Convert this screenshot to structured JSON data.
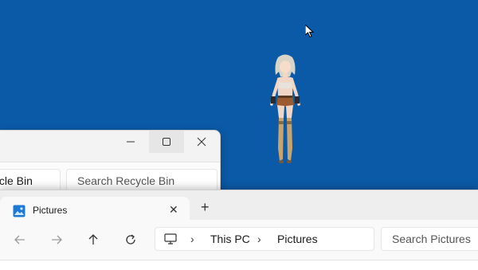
{
  "desktop": {
    "background": "#0b5aa7"
  },
  "recycle_window": {
    "breadcrumb": "Recycle Bin",
    "search_placeholder": "Search Recycle Bin",
    "controls": {
      "minimize": "—",
      "maximize": "☐",
      "close": "✕"
    }
  },
  "pictures_window": {
    "tab_label": "Pictures",
    "tab_close": "✕",
    "new_tab": "+",
    "nav": {
      "back": "←",
      "forward": "→",
      "up": "↑",
      "refresh": "↻"
    },
    "address": {
      "items": [
        "This PC",
        "Pictures"
      ],
      "separator": "›"
    },
    "search_placeholder": "Search Pictures"
  }
}
